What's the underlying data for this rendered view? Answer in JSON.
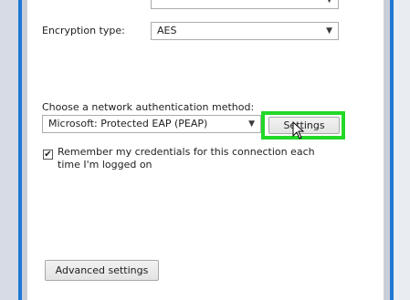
{
  "top_select": {
    "value": ""
  },
  "encryption": {
    "label": "Encryption type:",
    "value": "AES"
  },
  "auth_method": {
    "label": "Choose a network authentication method:",
    "value": "Microsoft: Protected EAP (PEAP)",
    "settings_label": "Settings"
  },
  "remember_credentials": {
    "checked": true,
    "mark": "✔",
    "line1": "Remember my credentials for this connection each",
    "line2": "time I'm logged on"
  },
  "advanced_settings_label": "Advanced settings",
  "icons": {
    "dropdown": "chevron-down-icon",
    "pointer": "mouse-pointer-icon",
    "check": "check-icon"
  },
  "colors": {
    "highlight": "#22d828",
    "window_accent": "#1e78d4"
  }
}
